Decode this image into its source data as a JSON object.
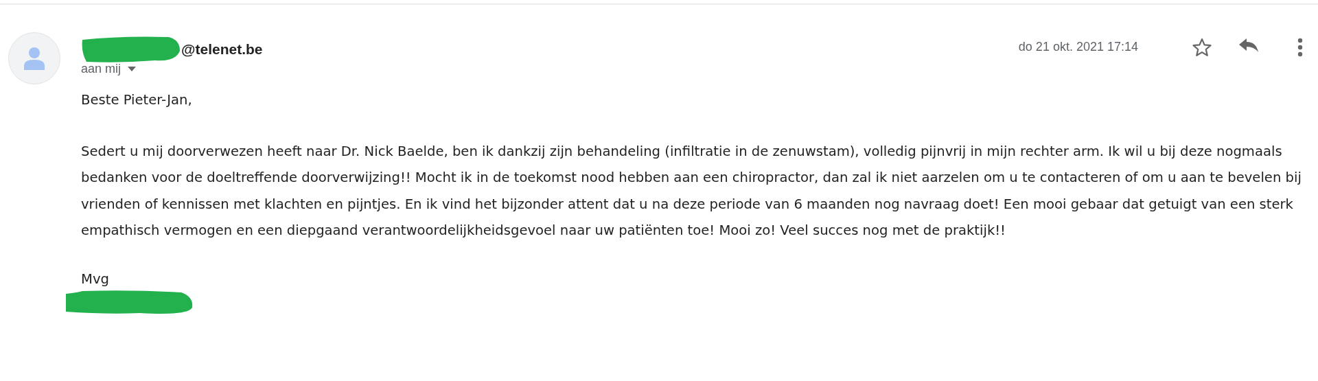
{
  "message": {
    "sender": "@telenet.be",
    "recipient": "aan mij",
    "date": "do 21 okt. 2021 17:14",
    "starred": false,
    "body": [
      "Beste Pieter-Jan,",
      "Sedert u mij doorverwezen heeft naar Dr. Nick Baelde, ben ik dankzij zijn behandeling (infiltratie in de zenuwstam), volledig pijnvrij in mijn rechter arm. Ik wil u bij deze nogmaals bedanken voor de doeltreffende doorverwijzing!! Mocht ik in de toekomst nood hebben aan een chiropractor, dan zal ik niet aarzelen om u te contacteren of om u aan te bevelen bij vrienden of kennissen met klachten en pijntjes. En ik vind het bijzonder attent dat u na deze periode van 6 maanden nog navraag doet! Een mooi gebaar dat getuigt van een sterk empathisch vermogen en een diepgaand verantwoordelijkheidsgevoel naar uw patiënten toe! Mooi zo! Veel succes nog met de praktijk!!",
      "Mvg"
    ]
  }
}
